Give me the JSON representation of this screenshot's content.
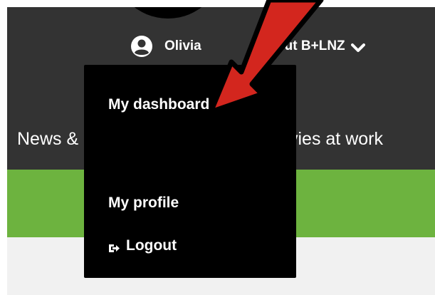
{
  "header": {
    "user_name": "Olivia",
    "about_label": "About B+LNZ",
    "user_icon": "user-circle-icon",
    "chevron_icon": "chevron-down-icon"
  },
  "subnav": {
    "left_text": "News &",
    "right_text": "vies at work"
  },
  "dropdown": {
    "items": [
      {
        "label": "My dashboard"
      },
      {
        "label": "My profile"
      },
      {
        "label": "Logout",
        "icon": "logout-icon"
      }
    ]
  },
  "annotation": {
    "arrow_icon": "red-arrow-icon",
    "arrow_color": "#d3261e"
  },
  "colors": {
    "topbar": "#333333",
    "green_band": "#6db33f",
    "dropdown_bg": "#000000",
    "page_bg": "#f1f1f1"
  }
}
